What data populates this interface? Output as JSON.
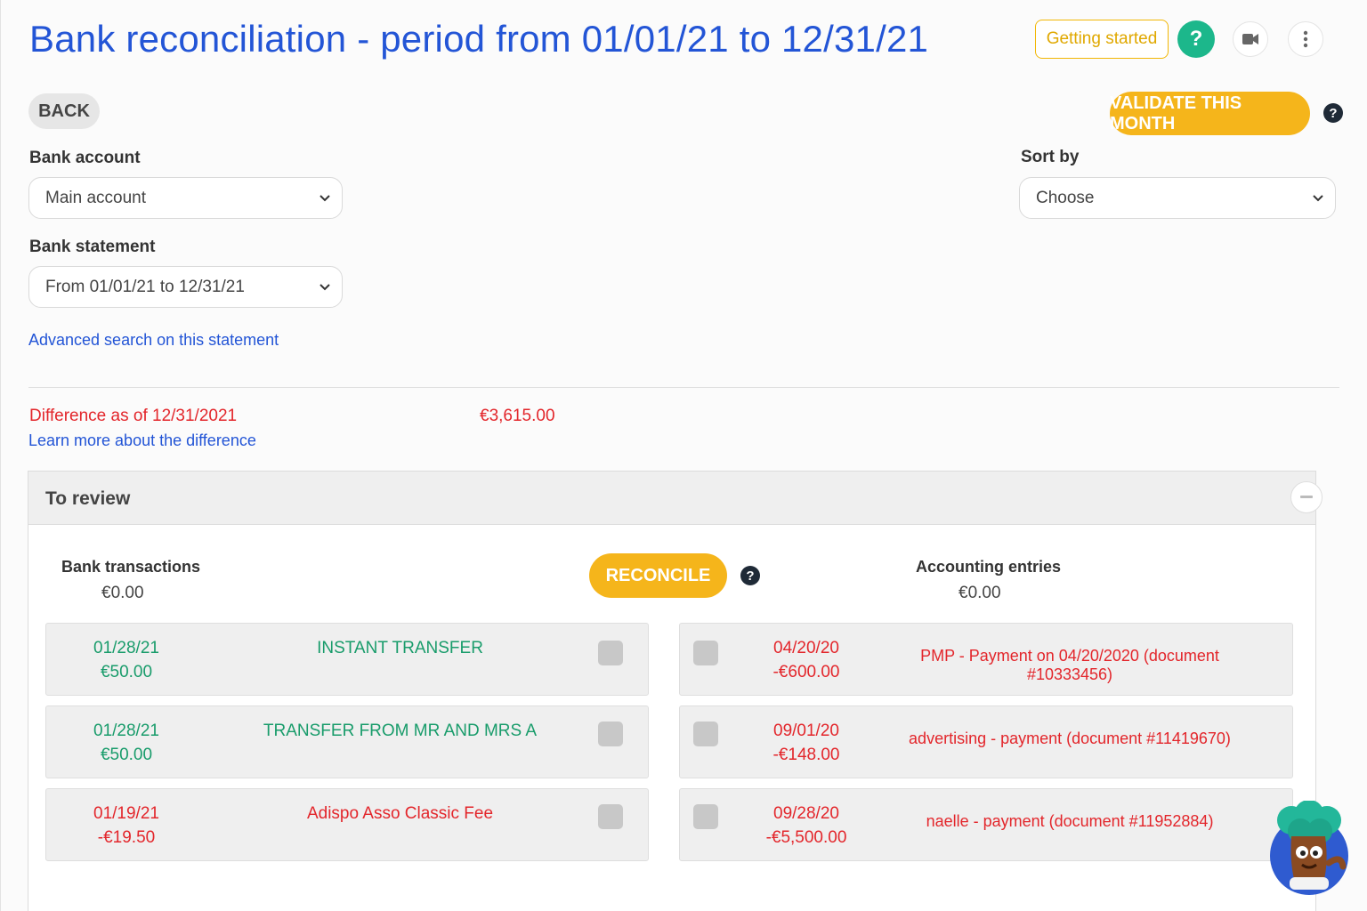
{
  "header": {
    "title": "Bank reconciliation - period from 01/01/21 to 12/31/21",
    "getting_started": "Getting started",
    "help_symbol": "?",
    "icons": [
      "help-icon",
      "video-icon",
      "more-vertical-icon"
    ]
  },
  "toolbar": {
    "back_label": "BACK",
    "validate_label": "VALIDATE THIS MONTH",
    "help_symbol": "?"
  },
  "filters": {
    "bank_account_label": "Bank account",
    "bank_account_value": "Main account",
    "bank_statement_label": "Bank statement",
    "bank_statement_value": "From 01/01/21 to 12/31/21",
    "sort_by_label": "Sort by",
    "sort_by_value": "Choose",
    "advanced_search": "Advanced search on this statement"
  },
  "difference": {
    "label": "Difference as of 12/31/2021",
    "amount": "€3,615.00",
    "learn_more": "Learn more about the difference"
  },
  "review": {
    "title": "To review",
    "bank_transactions_label": "Bank transactions",
    "bank_transactions_total": "€0.00",
    "reconcile_label": "RECONCILE",
    "accounting_entries_label": "Accounting entries",
    "accounting_entries_total": "€0.00",
    "bank_rows": [
      {
        "date": "01/28/21",
        "amount": "€50.00",
        "description": "INSTANT TRANSFER"
      },
      {
        "date": "01/28/21",
        "amount": "€50.00",
        "description": "TRANSFER FROM MR AND MRS A"
      },
      {
        "date": "01/19/21",
        "amount": "-€19.50",
        "description": "Adispo Asso Classic Fee"
      }
    ],
    "entry_rows": [
      {
        "date": "04/20/20",
        "amount": "-€600.00",
        "description": "PMP - Payment on 04/20/2020 (document #10333456)"
      },
      {
        "date": "09/01/20",
        "amount": "-€148.00",
        "description": "advertising - payment (document #11419670)"
      },
      {
        "date": "09/28/20",
        "amount": "-€5,500.00",
        "description": "naelle - payment (document #11952884)"
      }
    ]
  },
  "colors": {
    "title_blue": "#2355d6",
    "accent_yellow": "#f5b51b",
    "help_green": "#1cb78b",
    "positive_green": "#199c6b",
    "negative_red": "#e3262b"
  }
}
